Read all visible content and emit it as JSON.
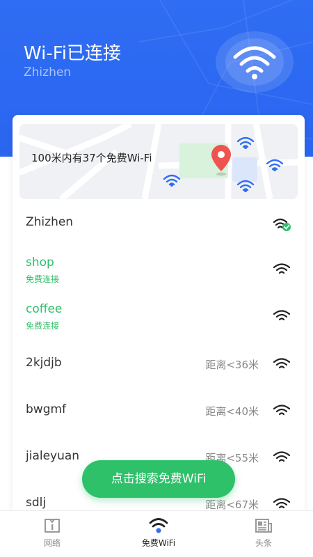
{
  "header": {
    "title": "Wi-Fi已连接",
    "subtitle": "Zhizhen",
    "bg_color": "#2f6df3"
  },
  "map": {
    "caption": "100米内有37个免费Wi-Fi",
    "pin_color": "#ef5350",
    "wifi_icon_color": "#2f6df3"
  },
  "networks": [
    {
      "name": "Zhizhen",
      "sub": "",
      "distance": "",
      "status": "connected"
    },
    {
      "name": "shop",
      "sub": "免费连接",
      "distance": "",
      "status": "free"
    },
    {
      "name": "coffee",
      "sub": "免费连接",
      "distance": "",
      "status": "free"
    },
    {
      "name": "2kjdjb",
      "sub": "",
      "distance": "距离<36米",
      "status": "locked"
    },
    {
      "name": "bwgmf",
      "sub": "",
      "distance": "距离<40米",
      "status": "locked"
    },
    {
      "name": "jialeyuan",
      "sub": "",
      "distance": "距离<55米",
      "status": "locked"
    },
    {
      "name": "sdlj",
      "sub": "",
      "distance": "距离<67米",
      "status": "locked"
    }
  ],
  "fab": {
    "label": "点击搜索免费WiFi",
    "color": "#2fc06a"
  },
  "bottom_nav": [
    {
      "label": "网络",
      "icon": "network-icon",
      "active": false
    },
    {
      "label": "免费WiFi",
      "icon": "wifi-icon",
      "active": true
    },
    {
      "label": "头条",
      "icon": "news-icon",
      "active": false
    }
  ]
}
